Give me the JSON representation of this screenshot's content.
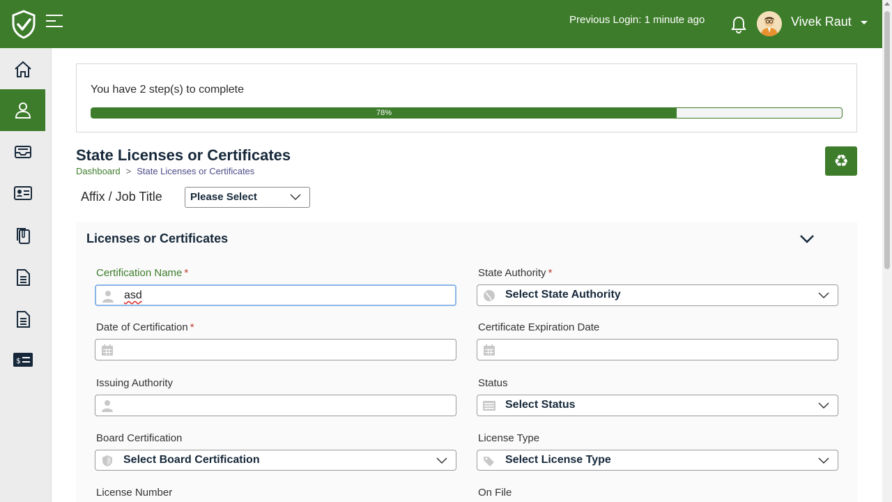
{
  "header": {
    "previous_login": "Previous Login: 1 minute ago",
    "user_name": "Vivek Raut"
  },
  "sidebar": {
    "items": [
      {
        "icon": "home-icon"
      },
      {
        "icon": "user-icon",
        "active": true
      },
      {
        "icon": "inbox-icon"
      },
      {
        "icon": "id-card-icon"
      },
      {
        "icon": "documents-icon"
      },
      {
        "icon": "file-icon"
      },
      {
        "icon": "file-alt-icon"
      },
      {
        "icon": "billing-icon"
      }
    ]
  },
  "progress": {
    "steps_text": "You have 2 step(s) to complete",
    "percent_label": "78%",
    "percent": 78
  },
  "page": {
    "title": "State Licenses or Certificates",
    "breadcrumb_home": "Dashboard",
    "breadcrumb_sep": ">",
    "breadcrumb_current": "State Licenses or Certificates",
    "recycle_icon": "♻"
  },
  "affix": {
    "label": "Affix / Job Title",
    "value": "Please Select"
  },
  "section": {
    "title": "Licenses or Certificates",
    "fields": {
      "certification_name": {
        "label": "Certification Name",
        "value": "asd"
      },
      "state_authority": {
        "label": "State Authority",
        "value": "Select State Authority"
      },
      "date_of_certification": {
        "label": "Date of Certification",
        "value": ""
      },
      "expiration_date": {
        "label": "Certificate Expiration Date",
        "value": ""
      },
      "issuing_authority": {
        "label": "Issuing Authority",
        "value": ""
      },
      "status": {
        "label": "Status",
        "value": "Select Status"
      },
      "board_certification": {
        "label": "Board Certification",
        "value": "Select Board Certification"
      },
      "license_type": {
        "label": "License Type",
        "value": "Select License Type"
      },
      "license_number": {
        "label": "License Number"
      },
      "on_file": {
        "label": "On File"
      }
    },
    "required_marker": "*"
  },
  "colors": {
    "brand_green": "#3d7c2b",
    "title_navy": "#16283a",
    "required_red": "#c0392b"
  }
}
